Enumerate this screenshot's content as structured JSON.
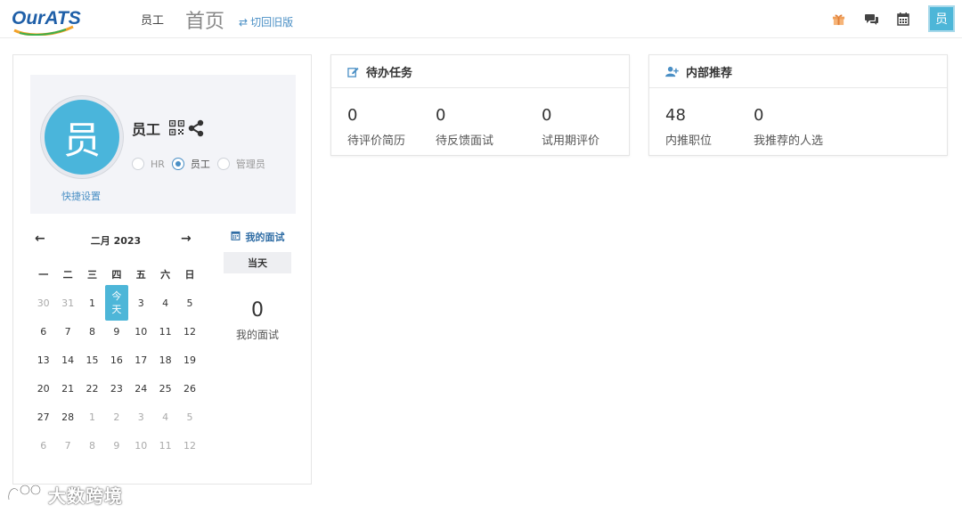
{
  "brand": {
    "logo_text": "OurATS",
    "accent": "#4db6d8",
    "link_color": "#4a8fc5"
  },
  "nav": {
    "user_label": "员工",
    "home_label": "首页",
    "switch_label": "切回旧版",
    "icons": [
      "gift-icon",
      "chat-icon",
      "calendar-icon"
    ],
    "avatar_text": "员"
  },
  "profile": {
    "avatar_text": "员",
    "name": "员工",
    "roles": [
      {
        "label": "HR",
        "checked": false
      },
      {
        "label": "员工",
        "checked": true
      },
      {
        "label": "管理员",
        "checked": false
      }
    ],
    "quick_settings": "快捷设置"
  },
  "calendar": {
    "title": "二月 2023",
    "weekdays": [
      "一",
      "二",
      "三",
      "四",
      "五",
      "六",
      "日"
    ],
    "today_label_lines": [
      "今",
      "天"
    ],
    "weeks": [
      [
        {
          "d": "30",
          "m": true
        },
        {
          "d": "31",
          "m": true
        },
        {
          "d": "1"
        },
        {
          "d": "today"
        },
        {
          "d": "3"
        },
        {
          "d": "4"
        },
        {
          "d": "5"
        }
      ],
      [
        {
          "d": "6"
        },
        {
          "d": "7"
        },
        {
          "d": "8"
        },
        {
          "d": "9"
        },
        {
          "d": "10"
        },
        {
          "d": "11"
        },
        {
          "d": "12"
        }
      ],
      [
        {
          "d": "13"
        },
        {
          "d": "14"
        },
        {
          "d": "15"
        },
        {
          "d": "16"
        },
        {
          "d": "17"
        },
        {
          "d": "18"
        },
        {
          "d": "19"
        }
      ],
      [
        {
          "d": "20"
        },
        {
          "d": "21"
        },
        {
          "d": "22"
        },
        {
          "d": "23"
        },
        {
          "d": "24"
        },
        {
          "d": "25"
        },
        {
          "d": "26"
        }
      ],
      [
        {
          "d": "27"
        },
        {
          "d": "28"
        },
        {
          "d": "1",
          "m": true
        },
        {
          "d": "2",
          "m": true
        },
        {
          "d": "3",
          "m": true
        },
        {
          "d": "4",
          "m": true
        },
        {
          "d": "5",
          "m": true
        }
      ],
      [
        {
          "d": "6",
          "m": true
        },
        {
          "d": "7",
          "m": true
        },
        {
          "d": "8",
          "m": true
        },
        {
          "d": "9",
          "m": true
        },
        {
          "d": "10",
          "m": true
        },
        {
          "d": "11",
          "m": true
        },
        {
          "d": "12",
          "m": true
        }
      ]
    ]
  },
  "interviews": {
    "link_label": "我的面试",
    "today_button": "当天",
    "count": "0",
    "count_label": "我的面试"
  },
  "todo": {
    "title": "待办任务",
    "stats": [
      {
        "value": "0",
        "label": "待评价简历"
      },
      {
        "value": "0",
        "label": "待反馈面试"
      },
      {
        "value": "0",
        "label": "试用期评价"
      }
    ]
  },
  "referral": {
    "title": "内部推荐",
    "stats": [
      {
        "value": "48",
        "label": "内推职位"
      },
      {
        "value": "0",
        "label": "我推荐的人选"
      }
    ]
  },
  "watermark": {
    "text": "大数跨境"
  }
}
